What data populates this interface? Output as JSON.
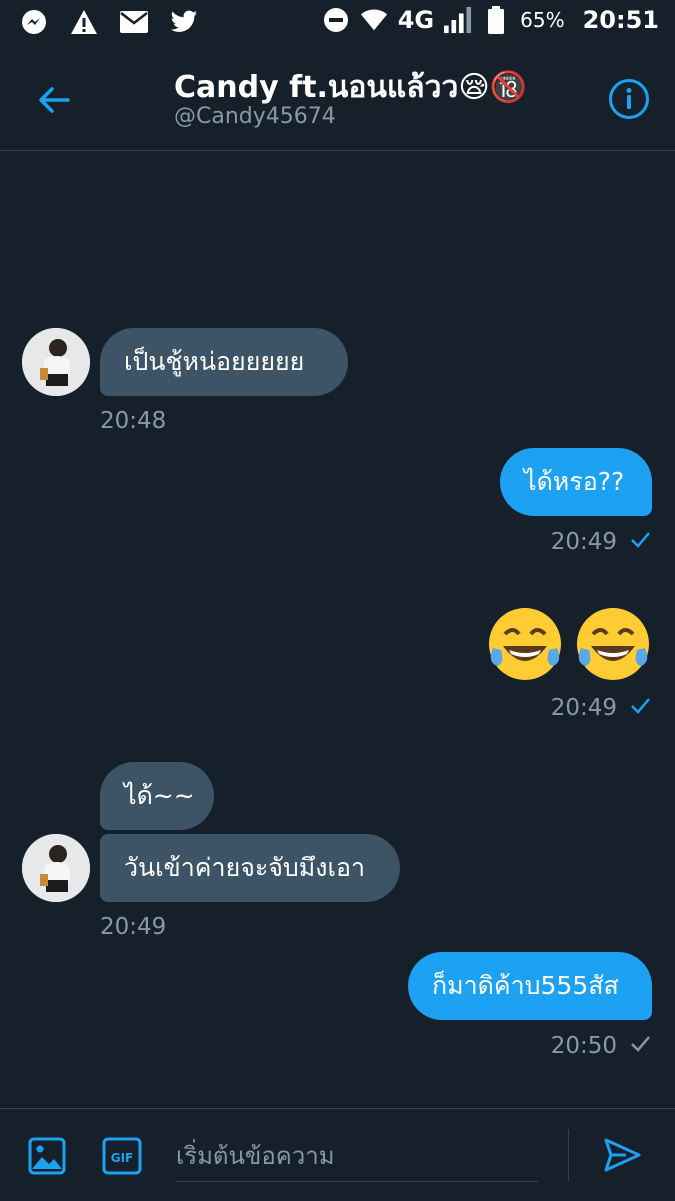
{
  "status_bar": {
    "network": "4G",
    "battery": "65%",
    "time": "20:51"
  },
  "header": {
    "name": "Candy ft.นอนแล้วว😪🔞",
    "handle": "@Candy45674"
  },
  "messages": [
    {
      "dir": "in",
      "text": "เป็นชู้หน่อยยยยย",
      "time": "20:48"
    },
    {
      "dir": "out",
      "text": "ได้หรอ??",
      "time": "20:49"
    },
    {
      "dir": "out",
      "text": "😂😂",
      "time": "20:49"
    },
    {
      "dir": "in",
      "text": "ได้~~"
    },
    {
      "dir": "in",
      "text": "วันเข้าค่ายจะจับมึงเอา",
      "time": "20:49"
    },
    {
      "dir": "out",
      "text": "ก็มาดิค้าบ555สัส",
      "time": "20:50"
    }
  ],
  "composer": {
    "placeholder": "เริ่มต้นข้อความ",
    "gif_label": "GIF"
  },
  "colors": {
    "background": "#15202b",
    "accent": "#1da1f2",
    "incoming_bubble": "#3d5466",
    "muted": "#8899a6"
  }
}
